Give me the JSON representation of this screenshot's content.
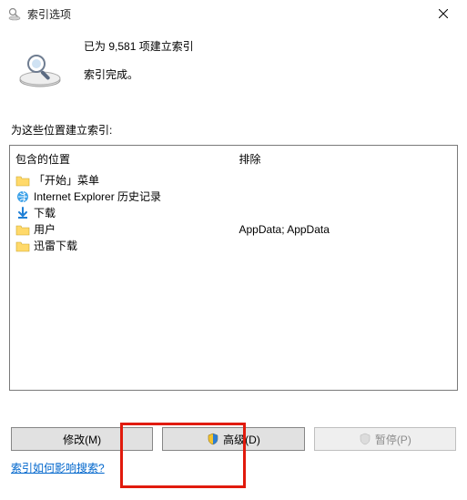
{
  "window": {
    "title": "索引选项",
    "close_glyph": "×"
  },
  "info": {
    "line1": "已为 9,581 项建立索引",
    "line2": "索引完成。"
  },
  "section_label": "为这些位置建立索引:",
  "included": {
    "header": "包含的位置",
    "items": [
      {
        "label": "「开始」菜单",
        "icon": "folder-icon"
      },
      {
        "label": "Internet Explorer 历史记录",
        "icon": "ie-icon"
      },
      {
        "label": "下载",
        "icon": "download-icon"
      },
      {
        "label": "用户",
        "icon": "folder-icon"
      },
      {
        "label": "迅雷下载",
        "icon": "folder-icon"
      }
    ]
  },
  "excluded": {
    "header": "排除",
    "items": [
      "",
      "",
      "",
      "AppData; AppData",
      ""
    ]
  },
  "buttons": {
    "modify": "修改(M)",
    "advanced": "高级(D)",
    "pause": "暂停(P)"
  },
  "help_link": "索引如何影响搜索?"
}
